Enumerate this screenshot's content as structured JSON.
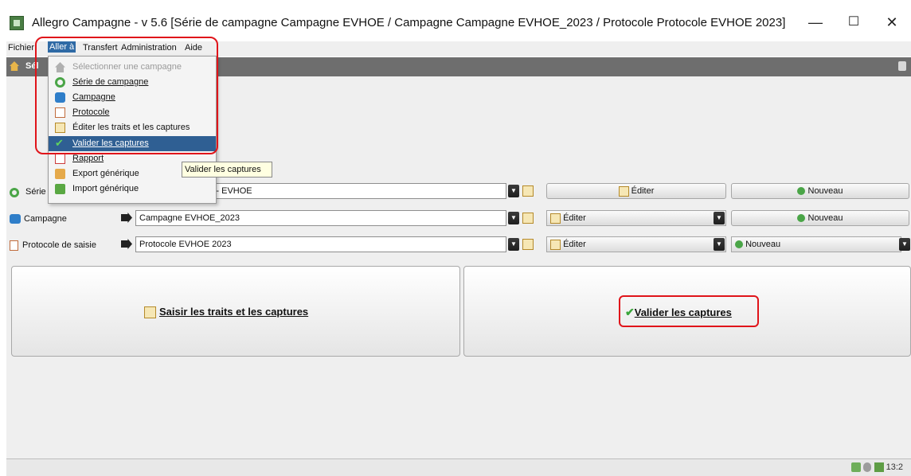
{
  "window": {
    "title": "Allegro Campagne - v 5.6 [Série de campagne Campagne EVHOE / Campagne Campagne EVHOE_2023 / Protocole Protocole EVHOE 2023]",
    "controls": {
      "minimize": "—",
      "maximize": "☐",
      "close": "✕"
    }
  },
  "menubar": {
    "items": [
      "Fichier",
      "Aller à",
      "Transfert",
      "Administration",
      "Aide"
    ]
  },
  "toolbar": {
    "tab_label": "Sél"
  },
  "dropdown": {
    "items": [
      {
        "label": "Sélectionner une campagne",
        "icon": "home-icon",
        "disabled": true
      },
      {
        "label": "Série de campagne",
        "icon": "series-icon"
      },
      {
        "label": "Campagne",
        "icon": "campaign-icon"
      },
      {
        "label": "Protocole",
        "icon": "protocol-icon"
      },
      {
        "label": "Éditer les traits et les captures",
        "icon": "edit-icon"
      },
      {
        "label": "Valider les captures",
        "icon": "check-icon",
        "highlighted": true
      },
      {
        "label": "Rapport",
        "icon": "report-icon"
      },
      {
        "label": "Export générique",
        "icon": "export-icon"
      },
      {
        "label": "Import générique",
        "icon": "import-icon"
      }
    ]
  },
  "tooltip": {
    "text": "Valider les captures"
  },
  "form": {
    "serie": {
      "label": "Série",
      "value": "E - EVHOE",
      "edit_label": "Éditer",
      "new_label": "Nouveau"
    },
    "campagne": {
      "label": "Campagne",
      "value": "Campagne EVHOE_2023",
      "edit_label": "Éditer",
      "new_label": "Nouveau"
    },
    "protocole": {
      "label": "Protocole de saisie",
      "value": "Protocole EVHOE 2023",
      "edit_label": "Éditer",
      "new_label": "Nouveau"
    }
  },
  "actions": {
    "saisir_label": "Saisir les traits et les captures",
    "valider_label": "Valider les captures"
  },
  "status": {
    "time": "13:2"
  },
  "colors": {
    "highlight": "#2f5f93",
    "annotation": "#e0141a",
    "check": "#3aa63a"
  }
}
